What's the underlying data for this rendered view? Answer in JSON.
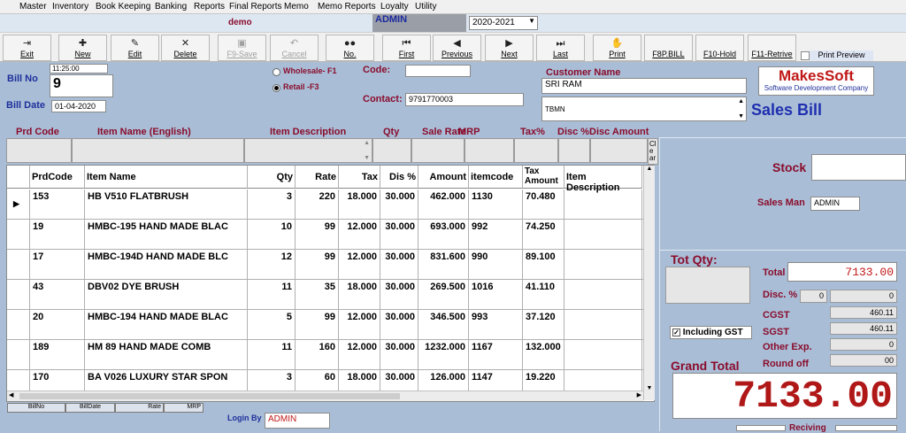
{
  "menu": [
    "Master",
    "Inventory",
    "Book Keeping",
    "Banking",
    "Reports",
    "Final Reports",
    "Memo",
    "Memo Reports",
    "Loyalty",
    "Utility"
  ],
  "top": {
    "company": "demo",
    "user": "ADMIN",
    "year": "2020-2021"
  },
  "toolbar": [
    {
      "label": "Exit",
      "icon": "exit-icon",
      "glyph": "⇥"
    },
    {
      "label": "New",
      "icon": "new-icon",
      "glyph": "✚"
    },
    {
      "label": "Edit",
      "icon": "edit-icon",
      "glyph": "✎"
    },
    {
      "label": "Delete",
      "icon": "delete-icon",
      "glyph": "✕"
    },
    {
      "label": "F9-Save",
      "icon": "save-icon",
      "glyph": "▣",
      "disabled": true
    },
    {
      "label": "Cancel",
      "icon": "cancel-icon",
      "glyph": "↶",
      "disabled": true
    },
    {
      "label": "No.",
      "icon": "binoculars-icon",
      "glyph": "●●"
    },
    {
      "label": "First",
      "icon": "first-icon",
      "glyph": "⏮"
    },
    {
      "label": "Previous",
      "icon": "previous-icon",
      "glyph": "◀"
    },
    {
      "label": "Next",
      "icon": "next-icon",
      "glyph": "▶"
    },
    {
      "label": "Last",
      "icon": "last-icon",
      "glyph": "⏭"
    },
    {
      "label": "Print",
      "icon": "print-icon",
      "glyph": "✋"
    },
    {
      "label": "F8P.BILL",
      "icon": "",
      "glyph": ""
    },
    {
      "label": "F10-Hold",
      "icon": "",
      "glyph": ""
    },
    {
      "label": "F11-Retrive",
      "icon": "",
      "glyph": ""
    }
  ],
  "print_preview": "Print Preview",
  "bill": {
    "time": "11:25:00",
    "bill_no_label": "Bill No",
    "bill_no": "9",
    "bill_date_label": "Bill Date",
    "bill_date": "01-04-2020",
    "wholesale_label": "Wholesale- F1",
    "retail_label": "Retail -F3",
    "code_label": "Code:",
    "code": "",
    "contact_label": "Contact:",
    "contact": "9791770003",
    "customer_name_label": "Customer Name",
    "customer_name": "SRI RAM",
    "customer_addr": "TBMN"
  },
  "brand": {
    "name": "MakesSoft",
    "tagline": "Software Development Company",
    "title": "Sales Bill"
  },
  "entry_headers": [
    "Prd Code",
    "Item Name (English)",
    "Item Description",
    "Qty",
    "Sale Rate",
    "MRP",
    "Tax%",
    "Disc %",
    "Disc Amount"
  ],
  "clear_btn": "Clear",
  "grid": {
    "columns": [
      "PrdCode",
      "Item Name",
      "Qty",
      "Rate",
      "Tax",
      "Dis %",
      "Amount",
      "itemcode",
      "Tax Amount",
      "Item Description"
    ],
    "rows": [
      [
        "153",
        "HB V510 FLATBRUSH",
        "3",
        "220",
        "18.000",
        "30.000",
        "462.000",
        "1130",
        "70.480",
        ""
      ],
      [
        "19",
        "HMBC-195 HAND MADE BLAC",
        "10",
        "99",
        "12.000",
        "30.000",
        "693.000",
        "992",
        "74.250",
        ""
      ],
      [
        "17",
        "HMBC-194D HAND MADE BLC",
        "12",
        "99",
        "12.000",
        "30.000",
        "831.600",
        "990",
        "89.100",
        ""
      ],
      [
        "43",
        "DBV02 DYE BRUSH",
        "11",
        "35",
        "18.000",
        "30.000",
        "269.500",
        "1016",
        "41.110",
        ""
      ],
      [
        "20",
        "HMBC-194 HAND MADE BLAC",
        "5",
        "99",
        "12.000",
        "30.000",
        "346.500",
        "993",
        "37.120",
        ""
      ],
      [
        "189",
        "HM 89 HAND MADE COMB",
        "11",
        "160",
        "12.000",
        "30.000",
        "1232.000",
        "1167",
        "132.000",
        ""
      ],
      [
        "170",
        "BA V026 LUXURY STAR SPON",
        "3",
        "60",
        "18.000",
        "30.000",
        "126.000",
        "1147",
        "19.220",
        ""
      ]
    ]
  },
  "footer": {
    "cols": [
      "BillNo",
      "BillDate",
      "Rate",
      "MRP"
    ],
    "login_label": "Login By",
    "login_user": "ADMIN"
  },
  "right": {
    "stock_label": "Stock",
    "salesman_label": "Sales Man",
    "salesman": "ADMIN",
    "tot_qty_label": "Tot Qty:",
    "total_label": "Total",
    "total": "7133.00",
    "disc_label": "Disc. %",
    "disc_pct": "0",
    "disc_amt": "0",
    "including_gst": "Including GST",
    "cgst_label": "CGST",
    "cgst": "460.11",
    "sgst_label": "SGST",
    "sgst": "460.11",
    "other_label": "Other Exp.",
    "other": "0",
    "round_label": "Round off",
    "round": "00",
    "grand_total_label": "Grand Total",
    "grand_total": "7133.00",
    "receiving_label": "Reciving"
  },
  "colors": {
    "background": "#a9bed6",
    "label_red": "#8a0c2c",
    "label_blue": "#1f2f9c",
    "grand_total": "#b01818"
  }
}
